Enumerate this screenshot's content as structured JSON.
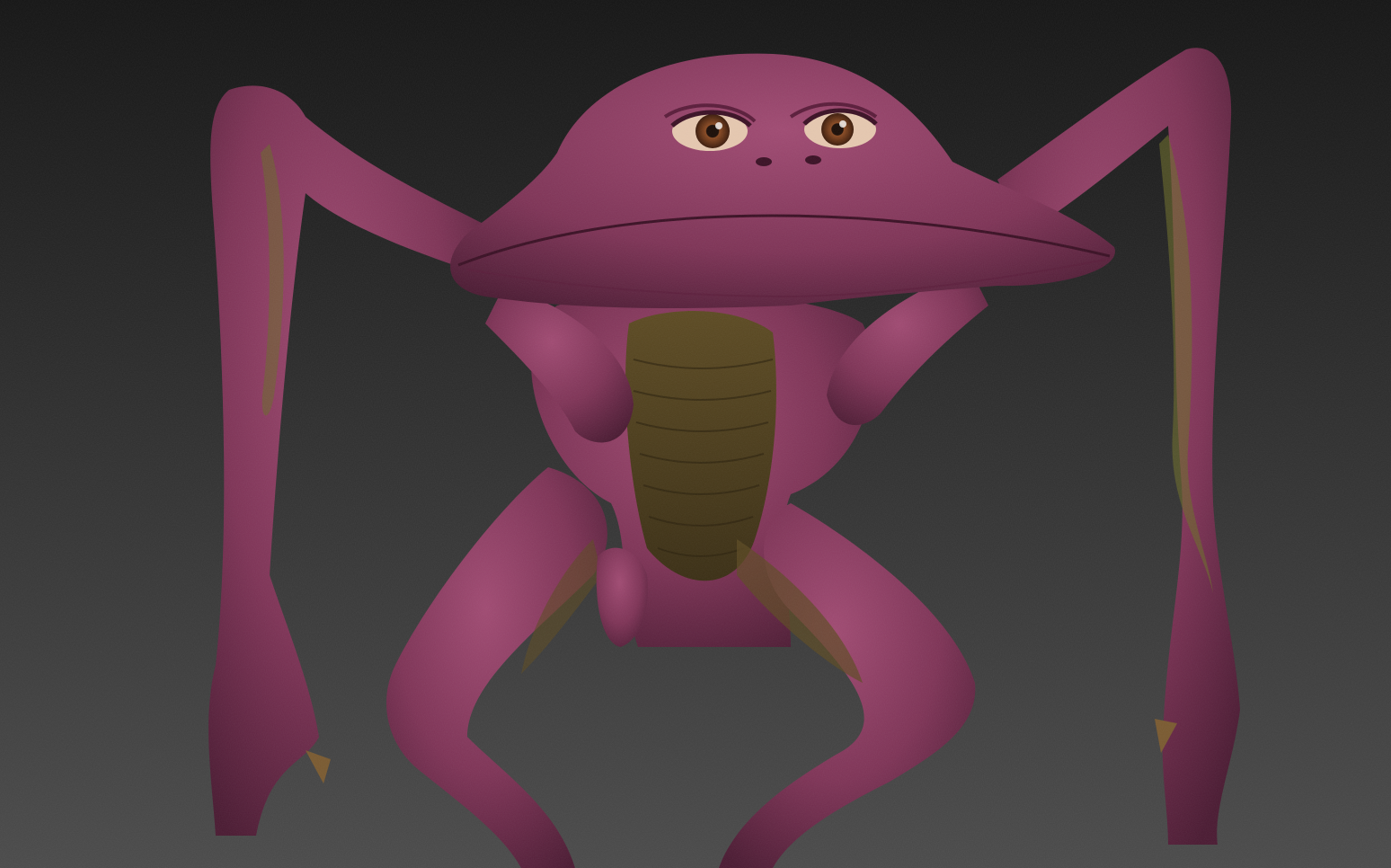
{
  "scene": {
    "subject": "creature-sculpt-render",
    "colors": {
      "background_top": "#141414",
      "background_bottom": "#4a4a4a",
      "skin": "#7e3356",
      "skin_shadow": "#4a1a32",
      "skin_highlight": "#a04a72",
      "belly": "#5c4a22",
      "belly_dark": "#3a2e14",
      "olive_tint": "#6a6a2a",
      "eye_iris": "#8a4a22",
      "eye_white": "#e6c8b0",
      "claw": "#7a5a30"
    }
  }
}
